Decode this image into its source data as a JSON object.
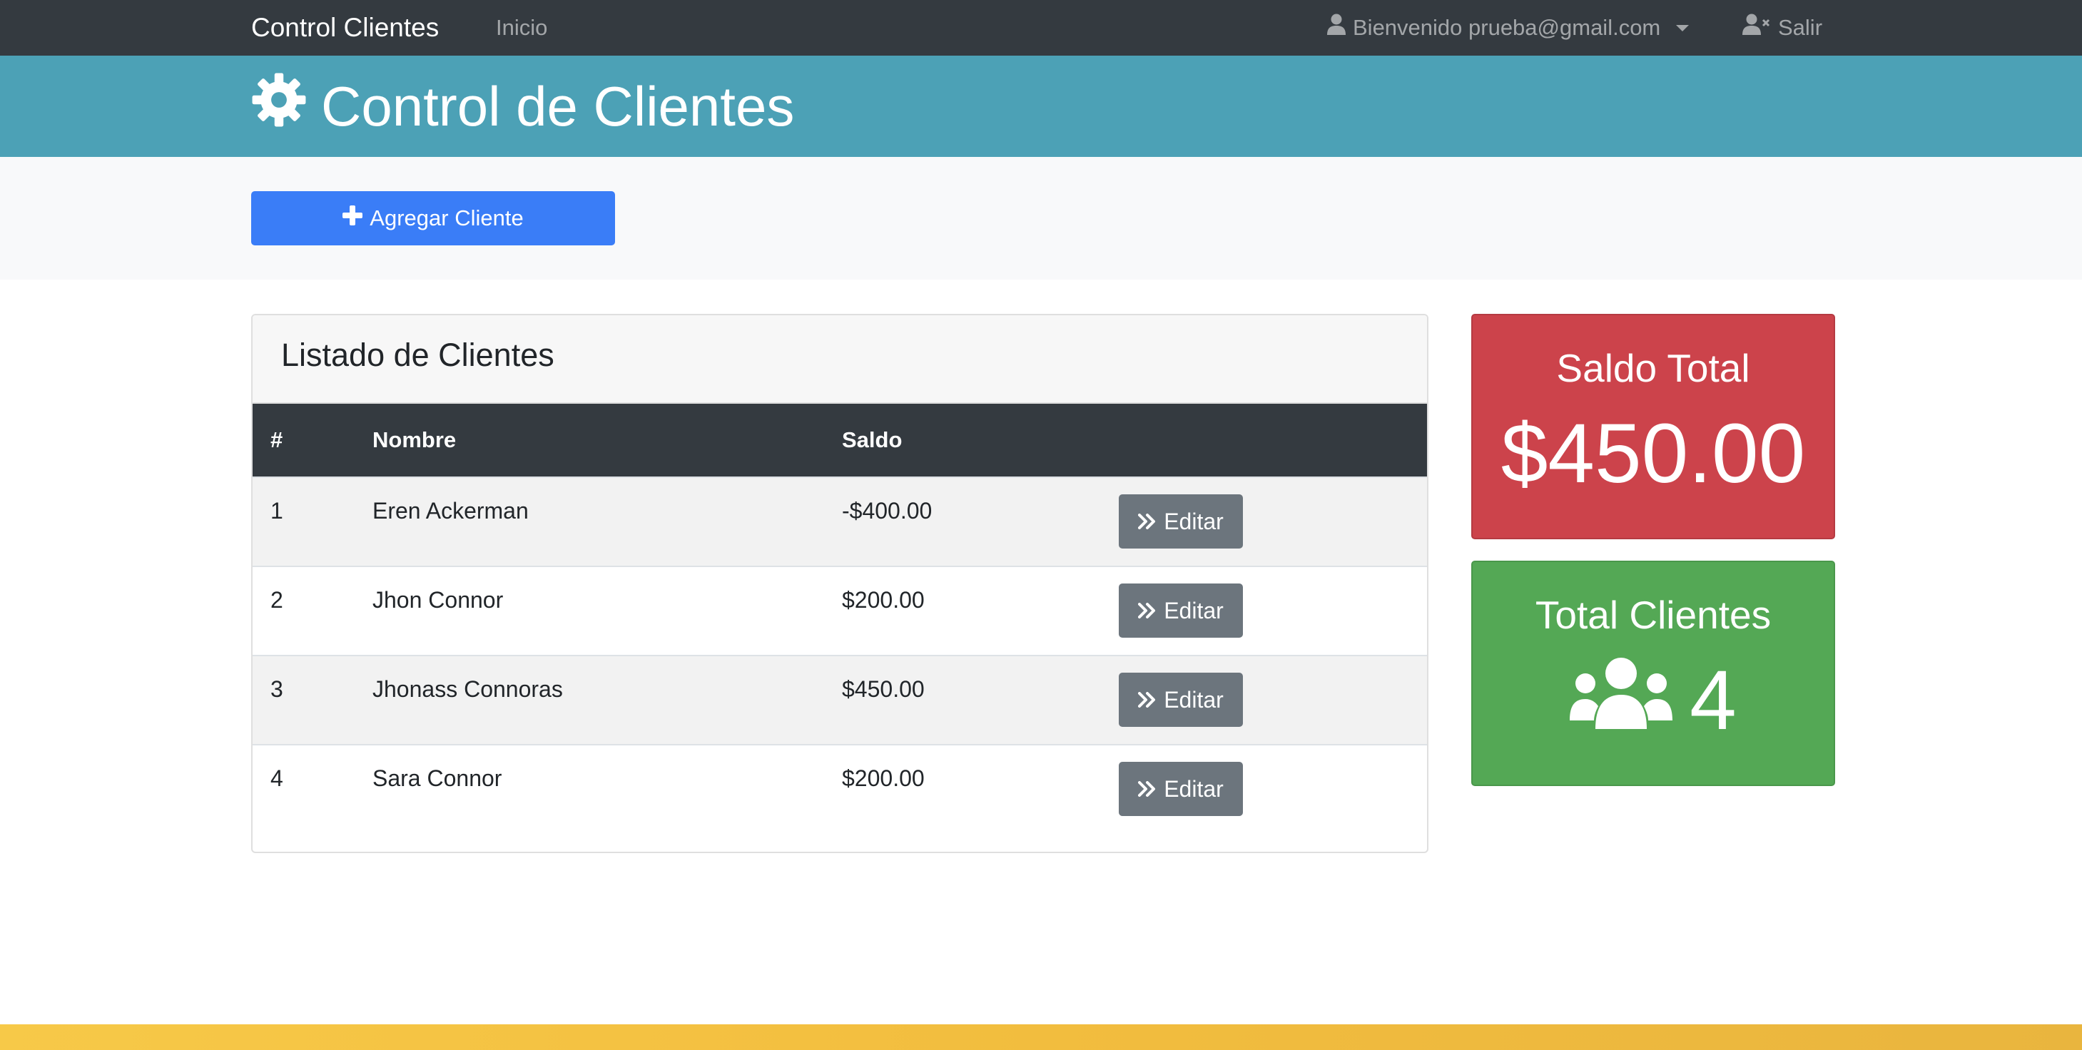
{
  "navbar": {
    "brand": "Control Clientes",
    "inicio": "Inicio",
    "user": "Bienvenido prueba@gmail.com",
    "salir": "Salir"
  },
  "header": {
    "title": "Control de Clientes"
  },
  "actions": {
    "add_label": "Agregar Cliente"
  },
  "clients": {
    "title": "Listado de Clientes",
    "columns": [
      "#",
      "Nombre",
      "Saldo"
    ],
    "rows": [
      {
        "num": "1",
        "name": "Eren Ackerman",
        "saldo": "-$400.00",
        "action": "Editar"
      },
      {
        "num": "2",
        "name": "Jhon Connor",
        "saldo": "$200.00",
        "action": "Editar"
      },
      {
        "num": "3",
        "name": "Jhonass Connoras",
        "saldo": "$450.00",
        "action": "Editar"
      },
      {
        "num": "4",
        "name": "Sara Connor",
        "saldo": "$200.00",
        "action": "Editar"
      }
    ]
  },
  "summary": {
    "saldo_label": "Saldo Total",
    "saldo_value": "$450.00",
    "total_label": "Total Clientes",
    "total_value": "4"
  },
  "icons": {
    "user": "user-icon",
    "user_x": "user-times-icon",
    "gear": "gear-icon",
    "plus": "plus-icon",
    "angles_right": "angles-right-icon",
    "users": "users-icon"
  },
  "colors": {
    "navbar": "#343a40",
    "header": "#4ca1b6",
    "primary": "#3a7df7",
    "secondary": "#6c757d",
    "danger": "#cc434b",
    "success": "#54a855",
    "footer": "#f2bd3e"
  }
}
